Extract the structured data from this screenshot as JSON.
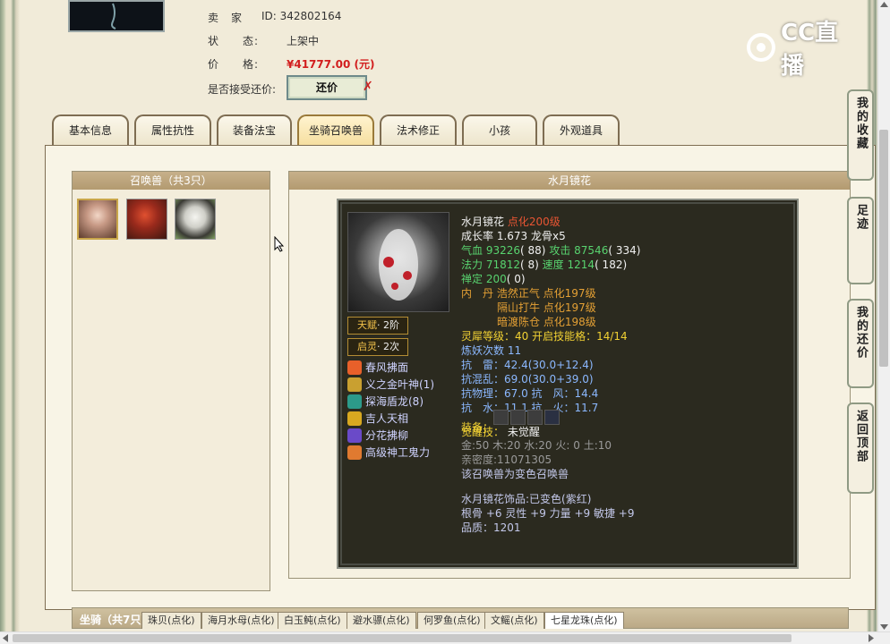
{
  "seller": {
    "label": "卖　家",
    "value": "ID:  342802164"
  },
  "status": {
    "label": "状　　态:",
    "value": "上架中"
  },
  "price": {
    "label": "价　　格:",
    "value": "¥41777.00 (元)"
  },
  "counter": {
    "label": "是否接受还价:",
    "button": "还价",
    "mark": "✗"
  },
  "logo": {
    "text": "CC直播"
  },
  "tabs": [
    "基本信息",
    "属性抗性",
    "装备法宝",
    "坐骑召唤兽",
    "法术修正",
    "小孩",
    "外观道具"
  ],
  "pets_panel": {
    "title": "召唤兽（共3只）"
  },
  "detail": {
    "title": "水月镜花",
    "name": "水月镜花",
    "name_level": "点化200级",
    "growth": "成长率 1.673 龙骨x5",
    "hp_label": "气血",
    "hp": "93226",
    "hp_b": "( 88)",
    "atk_label": "攻击",
    "atk": "87546",
    "atk_b": "( 334)",
    "mp_label": "法力",
    "mp": "71812",
    "mp_b": "( 8)",
    "spd_label": "速度",
    "spd": "1214",
    "spd_b": "( 182)",
    "zen_label": "禅定",
    "zen": "200",
    "zen_b": "( 0)",
    "neidan_label": "内　丹",
    "neidan": [
      "浩然正气 点化197级",
      "隔山打牛 点化197级",
      "暗渡陈仓 点化198级"
    ],
    "lingxi": "灵犀等级：40 开启技能格：14/14",
    "lianyao": "炼妖次数 11",
    "kang_lei": "抗　雷：42.4(30.0+12.4)",
    "kang_hunluan": "抗混乱：69.0(30.0+39.0)",
    "kang_wuli": "抗物理：67.0 抗　风：14.4",
    "kang_shui": "抗　水：11.1 抗　火：11.7",
    "equip_label": "装备：",
    "awaken_label": "觉醒技：",
    "awaken_value": "未觉醒",
    "elements": "金:50 木:20 水:20 火: 0 土:10",
    "intimacy": "亲密度:11071305",
    "variant": "该召唤兽为变色召唤兽",
    "ornament": "水月镜花饰品:已变色(紫红)",
    "attrs": "根骨 +6 灵性 +9 力量 +9 敏捷 +9",
    "quality": "品质：1201"
  },
  "badges": [
    {
      "name": "天赋",
      "value": "· 2阶"
    },
    {
      "name": "启灵",
      "value": "· 2次"
    }
  ],
  "skills": [
    "春风拂面",
    "义之金叶神(1)",
    "探海盾龙(8)",
    "吉人天相",
    "分花拂柳",
    "高级神工鬼力"
  ],
  "side_buttons": [
    "我的收藏",
    "足迹",
    "我的还价",
    "返回顶部"
  ],
  "mounts": {
    "label": "坐骑（共7只）",
    "tabs": [
      "珠贝(点化)",
      "海月水母(点化)",
      "白玉鲀(点化)",
      "避水骠(点化)",
      "何罗鱼(点化)",
      "文鳐(点化)",
      "七星龙珠(点化)"
    ]
  },
  "colors": {
    "price": "#d21e1e",
    "accent": "#f2c24b",
    "panel_dark": "#2b2a1f"
  }
}
